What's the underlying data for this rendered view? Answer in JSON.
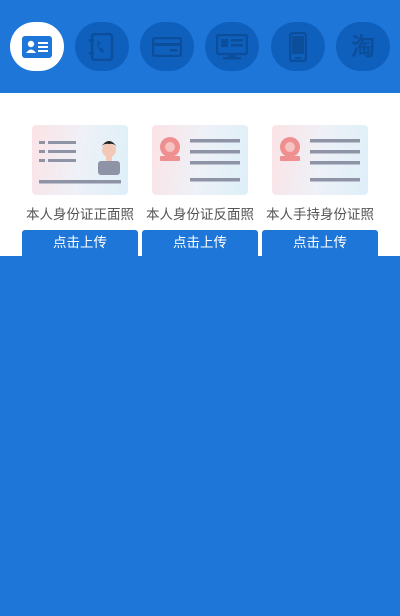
{
  "theme": {
    "primary": "#1d76d8",
    "step_inactive": "#0f5fbd",
    "step_icon": "#0b4e9c",
    "panel": "#ffffff"
  },
  "steps": [
    {
      "icon": "id-card-icon",
      "active": true
    },
    {
      "icon": "phone-book-icon",
      "active": false
    },
    {
      "icon": "bank-card-icon",
      "active": false
    },
    {
      "icon": "computer-icon",
      "active": false
    },
    {
      "icon": "mobile-phone-icon",
      "active": false
    },
    {
      "icon": "taobao-icon",
      "label": "淘",
      "active": false
    }
  ],
  "uploads": [
    {
      "caption": "本人身份证正面照",
      "button": "点击上传",
      "image": "id-card-front-icon"
    },
    {
      "caption": "本人身份证反面照",
      "button": "点击上传",
      "image": "id-card-back-icon"
    },
    {
      "caption": "本人手持身份证照",
      "button": "点击上传",
      "image": "id-card-handheld-icon"
    }
  ]
}
